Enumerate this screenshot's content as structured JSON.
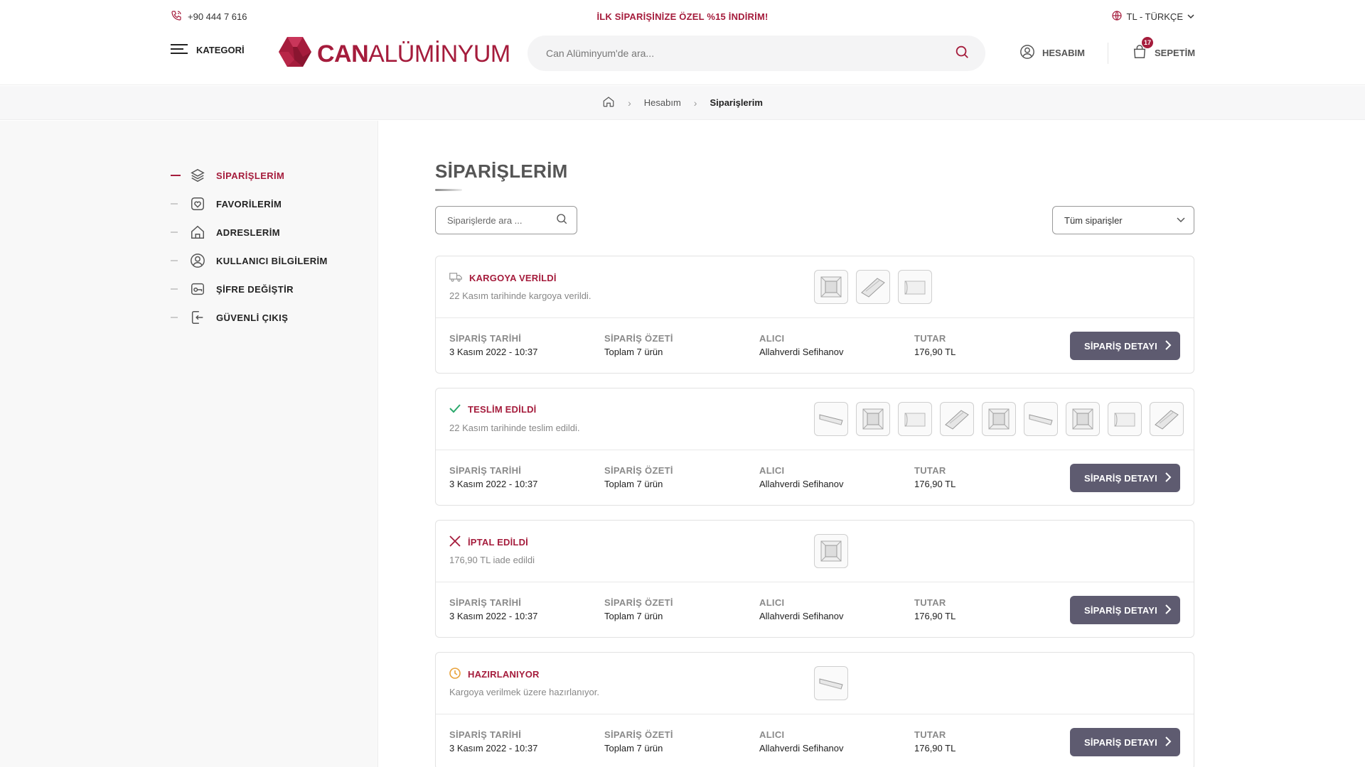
{
  "header": {
    "phone": "+90 444 7 616",
    "promo": "İLK SİPARİŞİNİZE ÖZEL %15 İNDİRİM!",
    "language": "TL - TÜRKÇE",
    "kategori": "KATEGORİ",
    "logo_bold": "CAN",
    "logo_light": "ALÜMİNYUM",
    "search_placeholder": "Can Alüminyum'de ara...",
    "account": "HESABIM",
    "cart": "SEPETİM",
    "cart_count": "17",
    "brand_color": "#a51c3c"
  },
  "breadcrumb": {
    "home": "home-icon",
    "items": [
      "Hesabım",
      "Siparişlerim"
    ]
  },
  "sidebar": {
    "items": [
      {
        "label": "SİPARİŞLERİM",
        "icon": "layers-icon",
        "active": true
      },
      {
        "label": "FAVORİLERİM",
        "icon": "heart-icon",
        "active": false
      },
      {
        "label": "ADRESLERİM",
        "icon": "house-icon",
        "active": false
      },
      {
        "label": "KULLANICI BİLGİLERİM",
        "icon": "user-icon",
        "active": false
      },
      {
        "label": "ŞİFRE DEĞİŞTİR",
        "icon": "key-icon",
        "active": false
      },
      {
        "label": "GÜVENLİ ÇIKIŞ",
        "icon": "logout-icon",
        "active": false
      }
    ]
  },
  "orders_page": {
    "title": "SİPARİŞLERİM",
    "search_placeholder": "Siparişlerde ara ...",
    "filter_selected": "Tüm siparişler",
    "col_labels": {
      "date": "SİPARİŞ TARİHİ",
      "summary": "SİPARİŞ ÖZETİ",
      "recipient": "ALICI",
      "total": "TUTAR"
    },
    "detail_button": "SİPARİŞ DETAYI"
  },
  "orders": [
    {
      "status": "KARGOYA VERİLDİ",
      "status_icon": "truck-icon",
      "status_color": "#a51c3c",
      "note": "22 Kasım tarihinde kargoya verildi.",
      "thumb_count": 3,
      "date": "3 Kasım 2022 - 10:37",
      "summary": "Toplam 7 ürün",
      "recipient": "Allahverdi Sefihanov",
      "total": "176,90 TL"
    },
    {
      "status": "TESLİM EDİLDİ",
      "status_icon": "check-icon",
      "status_color": "#2aa86b",
      "note": "22 Kasım tarihinde teslim edildi.",
      "thumb_count": 9,
      "date": "3 Kasım 2022 - 10:37",
      "summary": "Toplam 7 ürün",
      "recipient": "Allahverdi Sefihanov",
      "total": "176,90 TL"
    },
    {
      "status": "İPTAL EDİLDİ",
      "status_icon": "x-icon",
      "status_color": "#a51c3c",
      "note": "176,90 TL iade edildi",
      "thumb_count": 1,
      "date": "3 Kasım 2022 - 10:37",
      "summary": "Toplam 7 ürün",
      "recipient": "Allahverdi Sefihanov",
      "total": "176,90 TL"
    },
    {
      "status": "HAZIRLANIYOR",
      "status_icon": "clock-icon",
      "status_color": "#e8a13a",
      "note": "Kargoya verilmek üzere hazırlanıyor.",
      "thumb_count": 1,
      "date": "3 Kasım 2022 - 10:37",
      "summary": "Toplam 7 ürün",
      "recipient": "Allahverdi Sefihanov",
      "total": "176,90 TL"
    }
  ]
}
